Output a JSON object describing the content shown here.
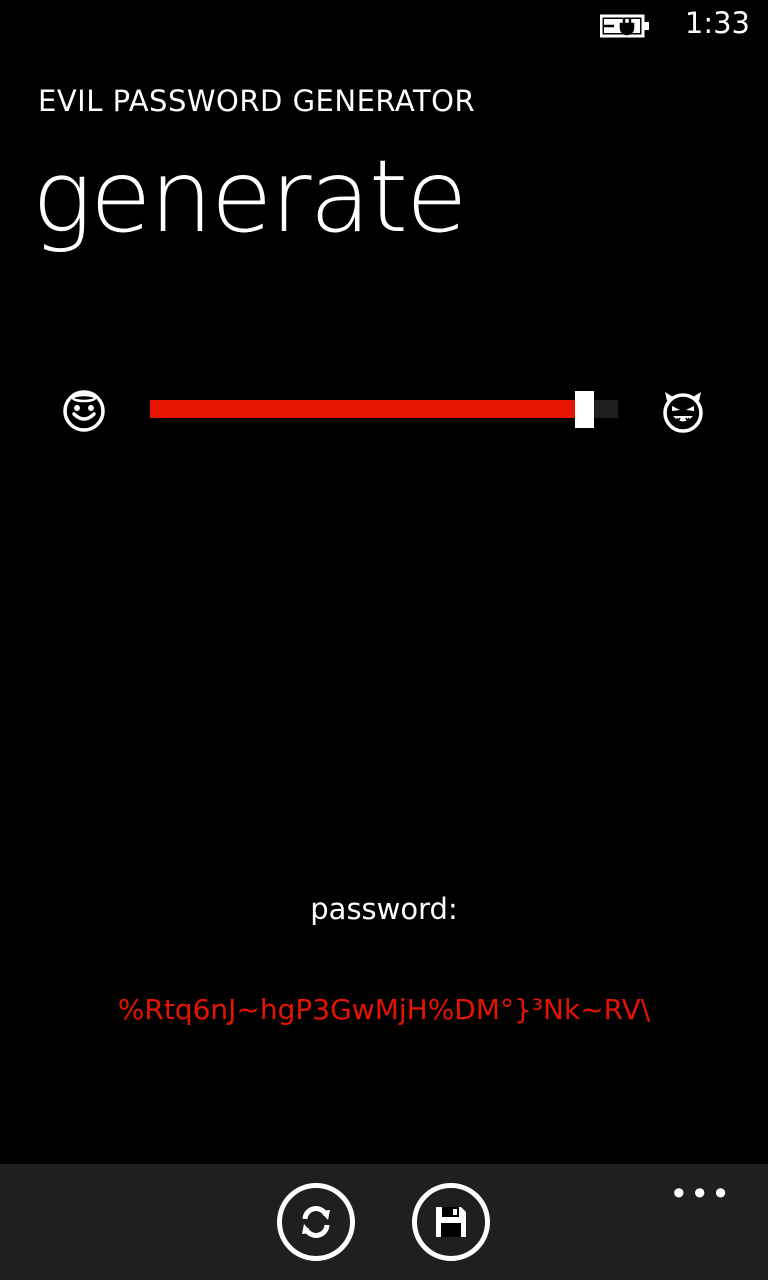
{
  "status": {
    "time": "1:33",
    "battery_icon": "battery-charging-icon"
  },
  "app": {
    "title": "EVIL PASSWORD GENERATOR",
    "page_title": "generate"
  },
  "slider": {
    "left_icon": "angel-face-icon",
    "right_icon": "devil-face-icon",
    "value": 0.93,
    "fill_color": "#e51400"
  },
  "password": {
    "label": "password:",
    "value": "%Rtq6nJ~hgP3GwMjH%DM°}³Nk~RV\\",
    "color": "#e51400"
  },
  "app_bar": {
    "more_label": "•••",
    "buttons": [
      {
        "name": "refresh",
        "icon": "refresh-icon"
      },
      {
        "name": "save",
        "icon": "save-icon"
      }
    ]
  }
}
